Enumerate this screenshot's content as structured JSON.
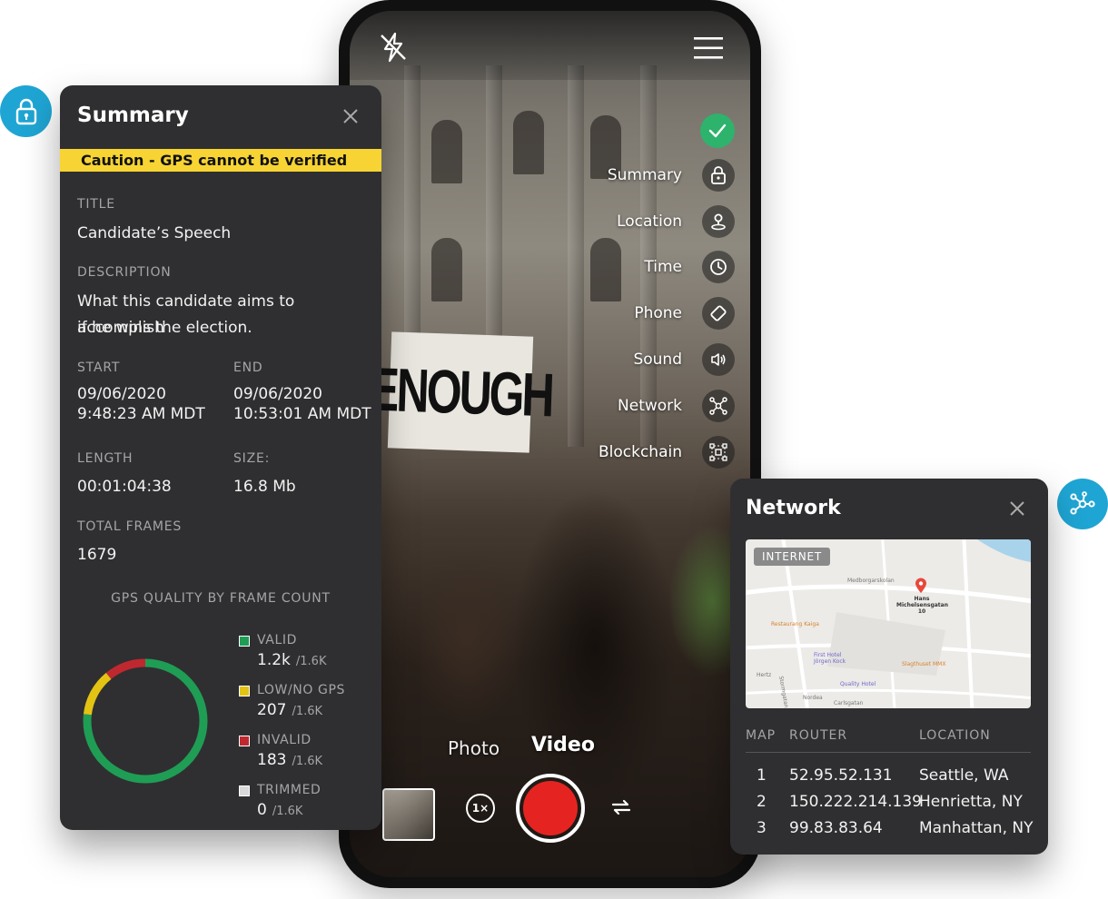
{
  "colors": {
    "accent_blue": "#1fa5d3",
    "panel": "#2f2f31",
    "caution": "#f7d433",
    "valid": "#1f9d55",
    "low_gps": "#e3c214",
    "invalid": "#c0282f",
    "trimmed": "#d9d9d9",
    "record": "#e52421",
    "check": "#2db36b"
  },
  "camera": {
    "sign_text": "ENOUGH",
    "menu": [
      {
        "label": "Summary",
        "icon": "lock-icon"
      },
      {
        "label": "Location",
        "icon": "location-pin-icon"
      },
      {
        "label": "Time",
        "icon": "clock-icon"
      },
      {
        "label": "Phone",
        "icon": "phone-rotate-icon"
      },
      {
        "label": "Sound",
        "icon": "speaker-icon"
      },
      {
        "label": "Network",
        "icon": "network-icon"
      },
      {
        "label": "Blockchain",
        "icon": "blockchain-icon"
      }
    ],
    "mode_photo": "Photo",
    "mode_video": "Video",
    "zoom": "1×"
  },
  "summary": {
    "title": "Summary",
    "caution": "Caution - GPS cannot be verified",
    "title_label": "TITLE",
    "title_value": "Candidate’s Speech",
    "description_label": "DESCRIPTION",
    "description_line1": "What this candidate aims to accomplish",
    "description_line2": "if he wins the election.",
    "start_label": "START",
    "start_date": "09/06/2020",
    "start_time": "9:48:23 AM MDT",
    "end_label": "END",
    "end_date": "09/06/2020",
    "end_time": "10:53:01 AM MDT",
    "length_label": "LENGTH",
    "length_value": "00:01:04:38",
    "size_label": "SIZE:",
    "size_value": "16.8 Mb",
    "frames_label": "TOTAL FRAMES",
    "frames_value": "1679",
    "gps_heading": "GPS QUALITY BY FRAME COUNT",
    "total_label": "/1.6K",
    "legend": [
      {
        "name": "VALID",
        "count": "1.2k",
        "total": "/1.6K"
      },
      {
        "name": "LOW/NO GPS",
        "count": "207",
        "total": "/1.6K"
      },
      {
        "name": "INVALID",
        "count": "183",
        "total": "/1.6K"
      },
      {
        "name": "TRIMMED",
        "count": "0",
        "total": "/1.6K"
      }
    ]
  },
  "chart_data": {
    "type": "pie",
    "title": "GPS QUALITY BY FRAME COUNT",
    "categories": [
      "VALID",
      "LOW/NO GPS",
      "INVALID",
      "TRIMMED"
    ],
    "values": [
      1289,
      207,
      183,
      0
    ],
    "total": 1679
  },
  "network": {
    "title": "Network",
    "map_badge": "INTERNET",
    "map_labels": [
      "Medborgarskolan",
      "Hans Michelsensgatan 10",
      "Restaurang Kaiga",
      "First Hotel Jörgen Kock",
      "Slagthuset MMX",
      "Quality Hotel",
      "Nordea",
      "Carlsgatan",
      "Hertz",
      "Stormgatan"
    ],
    "columns": [
      "MAP",
      "ROUTER",
      "LOCATION"
    ],
    "rows": [
      {
        "map": "1",
        "router": "52.95.52.131",
        "location": "Seattle, WA"
      },
      {
        "map": "2",
        "router": "150.222.214.139",
        "location": "Henrietta, NY"
      },
      {
        "map": "3",
        "router": "99.83.83.64",
        "location": "Manhattan, NY"
      }
    ]
  }
}
